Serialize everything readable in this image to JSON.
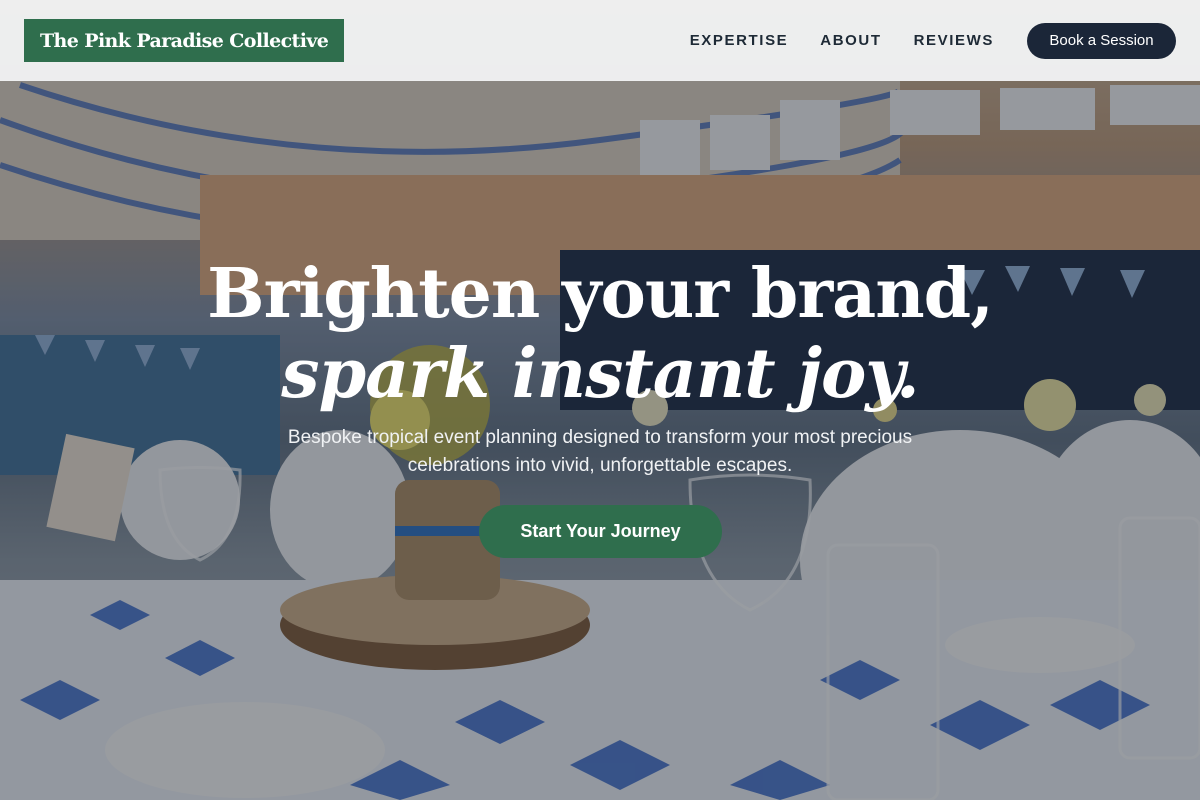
{
  "header": {
    "logo_text": "The Pink Paradise Collective",
    "nav": [
      {
        "label": "EXPERTISE"
      },
      {
        "label": "ABOUT"
      },
      {
        "label": "REVIEWS"
      }
    ],
    "cta_label": "Book a Session"
  },
  "hero": {
    "headline_line1": "Brighten your brand,",
    "headline_line2": "spark instant joy.",
    "subtitle": "Bespoke tropical event planning designed to transform your most precious celebrations into vivid, unforgettable escapes.",
    "cta_label": "Start Your Journey",
    "image_description": "banquet-hall-background"
  },
  "colors": {
    "brand_green": "#2f6e4d",
    "navy": "#1b2638",
    "header_bg": "#f4f5f6"
  }
}
